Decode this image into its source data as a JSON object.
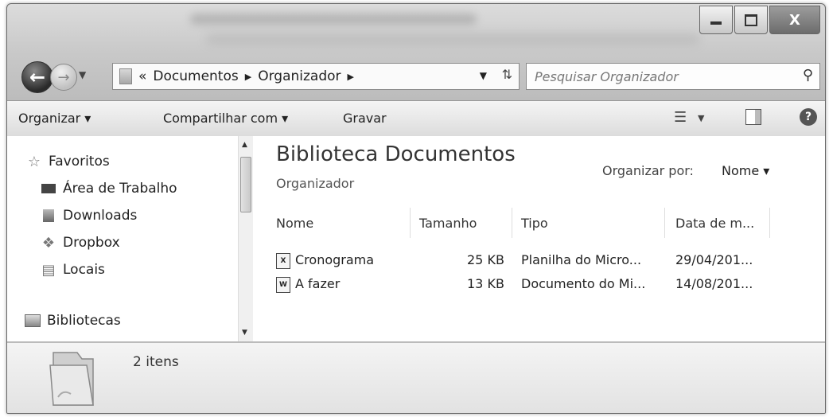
{
  "window": {
    "buttons": {
      "minimize_icon": "minimize-icon",
      "maximize_icon": "maximize-icon",
      "close_glyph": "X"
    }
  },
  "nav": {
    "address": {
      "overflow": "«",
      "segments": [
        "Documentos",
        "Organizador"
      ]
    },
    "search": {
      "placeholder": "Pesquisar Organizador"
    }
  },
  "toolbar": {
    "organize": "Organizar ▾",
    "share": "Compartilhar com ▾",
    "burn": "Gravar",
    "help": "?"
  },
  "sidebar": {
    "favorites": {
      "label": "Favoritos",
      "icon": "star-icon"
    },
    "items": [
      {
        "label": "Área de Trabalho",
        "icon": "desktop-icon"
      },
      {
        "label": "Downloads",
        "icon": "downloads-icon"
      },
      {
        "label": "Dropbox",
        "icon": "dropbox-icon"
      },
      {
        "label": "Locais",
        "icon": "places-icon"
      }
    ],
    "libraries": {
      "label": "Bibliotecas",
      "icon": "library-icon"
    }
  },
  "main": {
    "library_title": "Biblioteca Documentos",
    "subtitle": "Organizador",
    "arrange_label": "Organizar por:",
    "arrange_value": "Nome ▾",
    "columns": [
      "Nome",
      "Tamanho",
      "Tipo",
      "Data de m..."
    ],
    "files": [
      {
        "name": "Cronograma",
        "size": "25 KB",
        "type": "Planilha do Micro...",
        "date": "29/04/201...",
        "icon": "excel-file-icon"
      },
      {
        "name": "A fazer",
        "size": "13 KB",
        "type": "Documento do Mi...",
        "date": "14/08/201...",
        "icon": "word-file-icon"
      }
    ]
  },
  "details": {
    "count": "2 itens"
  }
}
